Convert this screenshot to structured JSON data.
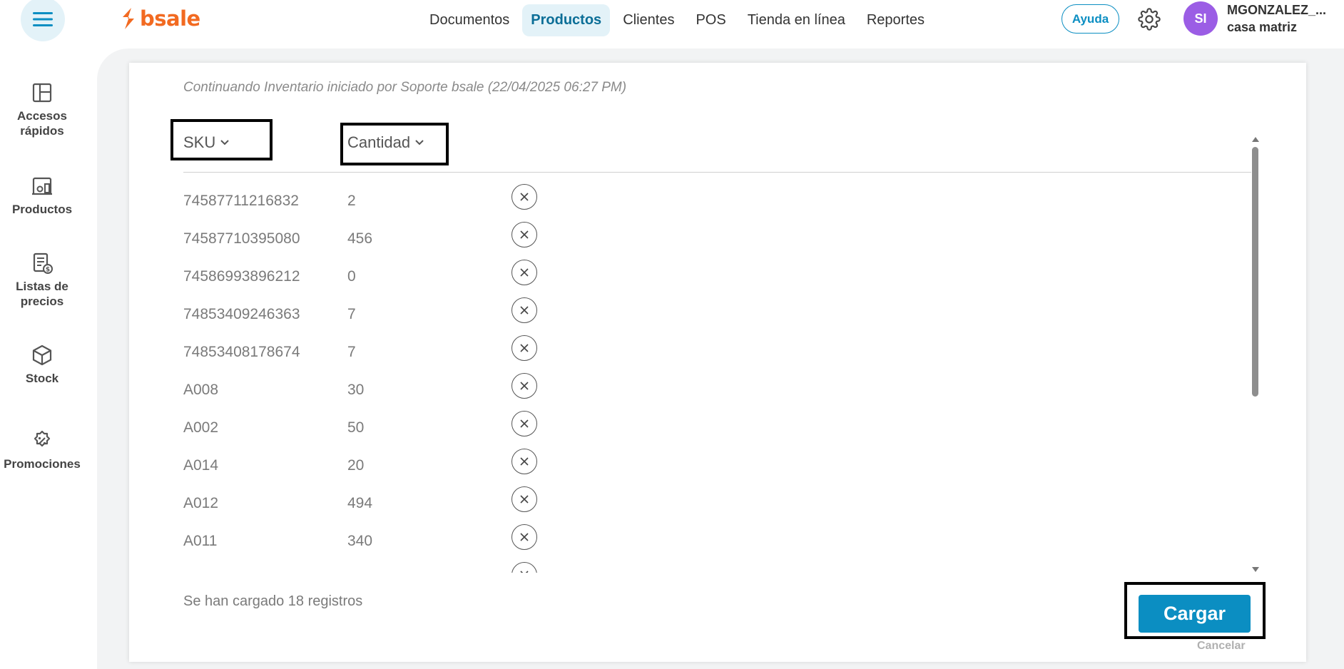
{
  "header": {
    "logo_text": "bsale",
    "nav": [
      {
        "label": "Documentos",
        "active": false
      },
      {
        "label": "Productos",
        "active": true
      },
      {
        "label": "Clientes",
        "active": false
      },
      {
        "label": "POS",
        "active": false
      },
      {
        "label": "Tienda en línea",
        "active": false
      },
      {
        "label": "Reportes",
        "active": false
      }
    ],
    "help_label": "Ayuda",
    "avatar_initials": "SI",
    "user_name": "MGONZALEZ_...",
    "user_branch": "casa matriz"
  },
  "sidebar": {
    "items": [
      {
        "label": "Accesos\nrápidos",
        "icon": "layout-icon"
      },
      {
        "label": "Productos",
        "icon": "products-icon"
      },
      {
        "label": "Listas de\nprecios",
        "icon": "price-list-icon"
      },
      {
        "label": "Stock",
        "icon": "box-icon"
      },
      {
        "label": "Promociones",
        "icon": "discount-icon"
      }
    ]
  },
  "inventory": {
    "subtitle": "Continuando Inventario iniciado por Soporte bsale (22/04/2025 06:27 PM)",
    "columns": {
      "sku": "SKU",
      "quantity": "Cantidad"
    },
    "rows": [
      {
        "sku": "74587711216832",
        "qty": "2"
      },
      {
        "sku": "74587710395080",
        "qty": "456"
      },
      {
        "sku": "74586993896212",
        "qty": "0"
      },
      {
        "sku": "74853409246363",
        "qty": "7"
      },
      {
        "sku": "74853408178674",
        "qty": "7"
      },
      {
        "sku": "A008",
        "qty": "30"
      },
      {
        "sku": "A002",
        "qty": "50"
      },
      {
        "sku": "A014",
        "qty": "20"
      },
      {
        "sku": "A012",
        "qty": "494"
      },
      {
        "sku": "A011",
        "qty": "340"
      },
      {
        "sku": "",
        "qty": ""
      }
    ],
    "records_text": "Se han cargado 18 registros",
    "load_label": "Cargar",
    "cancel_label": "Cancelar"
  },
  "colors": {
    "brand_orange": "#f26a21",
    "accent_blue": "#0b8ec2",
    "avatar_purple": "#9b5de5"
  }
}
